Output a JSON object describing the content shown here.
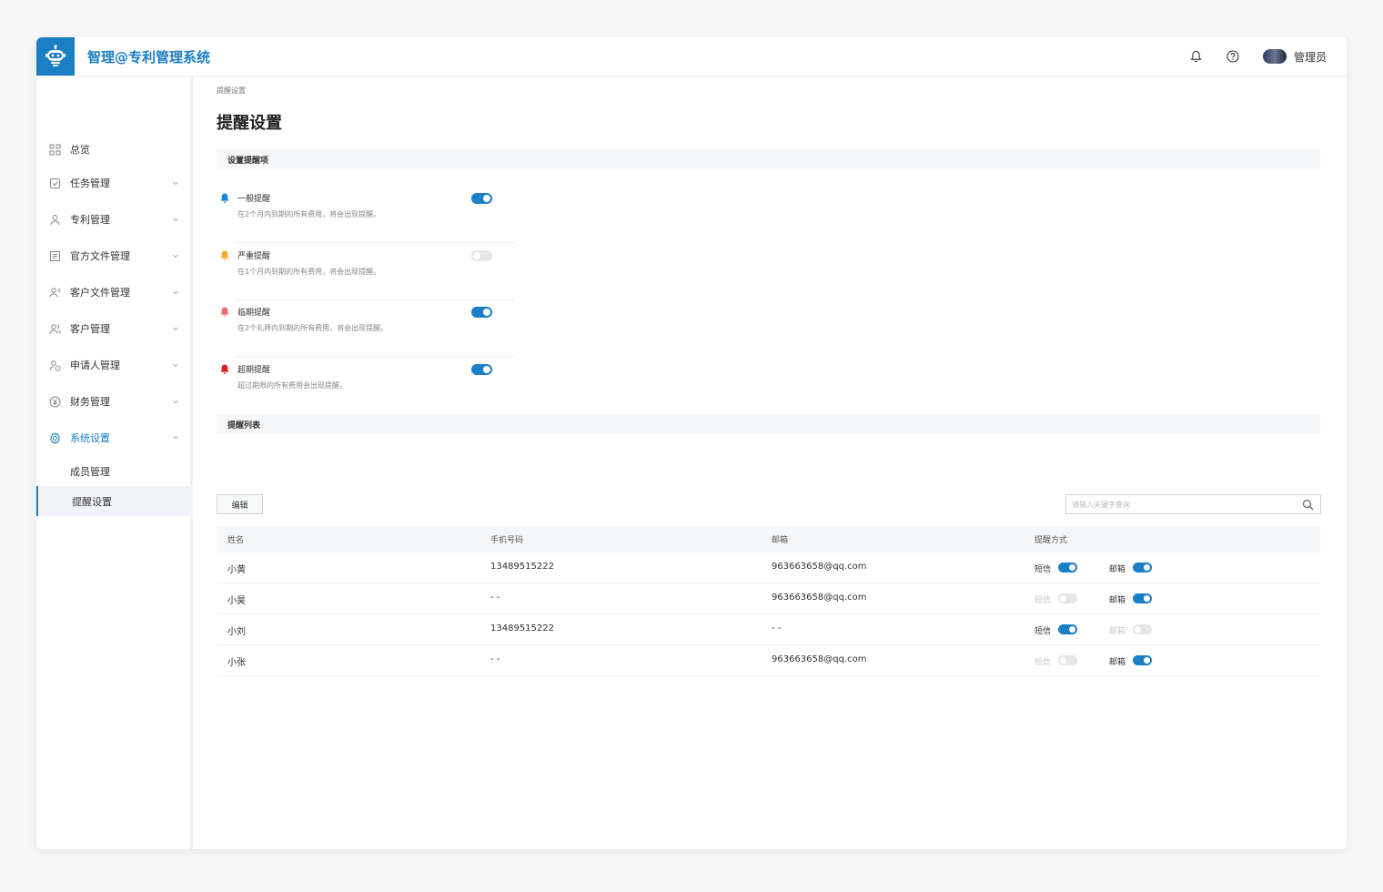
{
  "app": {
    "title": "智理@专利管理系统",
    "user_name": "管理员"
  },
  "sidebar": {
    "items": [
      {
        "label": "总览",
        "icon": "grid-icon",
        "chevron": false
      },
      {
        "label": "任务管理",
        "icon": "task-icon",
        "chevron": true
      },
      {
        "label": "专利管理",
        "icon": "patent-icon",
        "chevron": true
      },
      {
        "label": "官方文件管理",
        "icon": "document-icon",
        "chevron": true
      },
      {
        "label": "客户文件管理",
        "icon": "client-file-icon",
        "chevron": true
      },
      {
        "label": "客户管理",
        "icon": "client-icon",
        "chevron": true
      },
      {
        "label": "申请人管理",
        "icon": "applicant-icon",
        "chevron": true
      },
      {
        "label": "财务管理",
        "icon": "finance-icon",
        "chevron": true
      },
      {
        "label": "系统设置",
        "icon": "settings-icon",
        "chevron": true,
        "expanded": true,
        "active": true
      }
    ],
    "sub_items": [
      {
        "label": "成员管理"
      },
      {
        "label": "提醒设置",
        "selected": true
      }
    ]
  },
  "main": {
    "breadcrumb": "提醒设置",
    "page_title": "提醒设置",
    "section_settings": "设置提醒项",
    "section_list": "提醒列表",
    "reminders": [
      {
        "title": "一般提醒",
        "desc": "在2个月内到期的所有费用，将会出现提醒。",
        "bell_color": "#1a86d6",
        "enabled": true
      },
      {
        "title": "严重提醒",
        "desc": "在1个月内到期的所有费用，将会出现提醒。",
        "bell_color": "#f2b01e",
        "enabled": false
      },
      {
        "title": "临期提醒",
        "desc": "在2个礼拜内到期的所有费用，将会出现提醒。",
        "bell_color": "#f06d6d",
        "enabled": true
      },
      {
        "title": "超期提醒",
        "desc": "超过期限的所有费用会出现提醒。",
        "bell_color": "#e02020",
        "enabled": true
      }
    ],
    "edit_label": "编辑",
    "search_placeholder": "请输入关键字查询",
    "table": {
      "headers": [
        "姓名",
        "手机号码",
        "邮箱",
        "提醒方式"
      ],
      "sms_label": "短信",
      "email_label": "邮箱",
      "rows": [
        {
          "name": "小黄",
          "phone": "13489515222",
          "email": "963663658@qq.com",
          "sms": true,
          "mail": true
        },
        {
          "name": "小昊",
          "phone": "- -",
          "email": "963663658@qq.com",
          "sms": false,
          "mail": true
        },
        {
          "name": "小刘",
          "phone": "13489515222",
          "email": "- -",
          "sms": true,
          "mail": false
        },
        {
          "name": "小张",
          "phone": "- -",
          "email": "963663658@qq.com",
          "sms": false,
          "mail": true
        }
      ]
    }
  },
  "colors": {
    "accent": "#1a7fc4",
    "toggle_off": "#e6e6e6"
  }
}
